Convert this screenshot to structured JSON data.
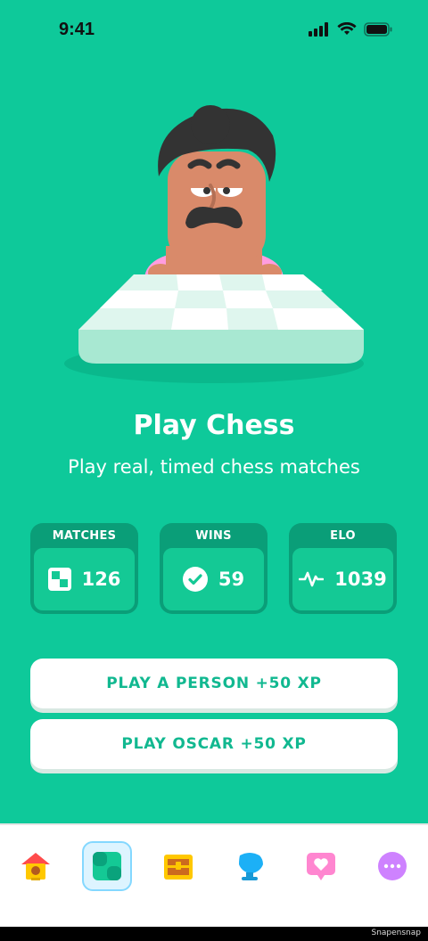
{
  "status": {
    "time": "9:41"
  },
  "hero": {
    "title": "Play Chess",
    "subtitle": "Play real, timed chess matches"
  },
  "stats": [
    {
      "label": "MATCHES",
      "value": "126",
      "icon": "chessboard-icon"
    },
    {
      "label": "WINS",
      "value": "59",
      "icon": "check-circle-icon"
    },
    {
      "label": "ELO",
      "value": "1039",
      "icon": "activity-pulse-icon"
    }
  ],
  "buttons": {
    "play_person": "PLAY A PERSON +50 XP",
    "play_oscar": "PLAY OSCAR +50 XP"
  },
  "tabbar": {
    "active": "chess",
    "items": [
      "home-icon",
      "chess-icon",
      "treasure-chest-icon",
      "trophy-icon",
      "heart-message-icon",
      "more-icon"
    ]
  },
  "colors": {
    "background": "#0ec99a",
    "card": "#0a9e78",
    "button_text": "#11b890"
  },
  "footer": {
    "credit": "Snapensnap"
  }
}
